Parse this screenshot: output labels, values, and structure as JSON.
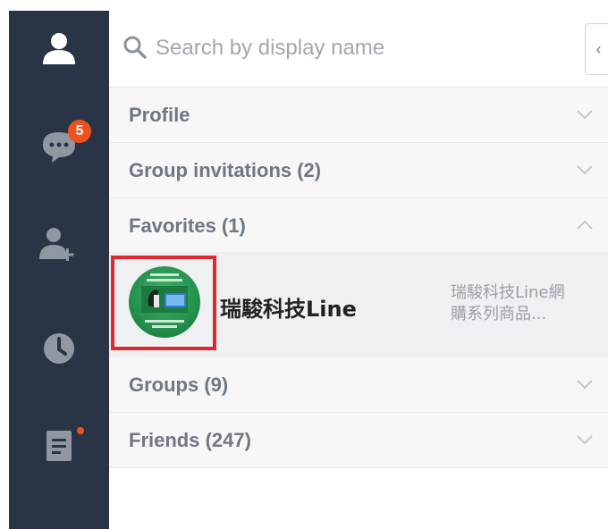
{
  "search": {
    "placeholder": "Search by display name"
  },
  "rail": {
    "chats_badge": "5",
    "icons": [
      "profile-icon",
      "chats-icon",
      "add-friend-icon",
      "clock-icon",
      "notes-icon"
    ]
  },
  "sections": {
    "profile": "Profile",
    "group_invitations": "Group invitations (2)",
    "favorites": "Favorites (1)",
    "groups": "Groups (9)",
    "friends": "Friends (247)"
  },
  "favorite_item": {
    "name": "瑞駿科技Line",
    "status_line1": "瑞駿科技Line網",
    "status_line2": "購系列商品..."
  },
  "colors": {
    "rail": "#2a3447",
    "badge": "#f0521e",
    "highlight_frame": "#e0282e",
    "avatar": "#2a9a55"
  }
}
